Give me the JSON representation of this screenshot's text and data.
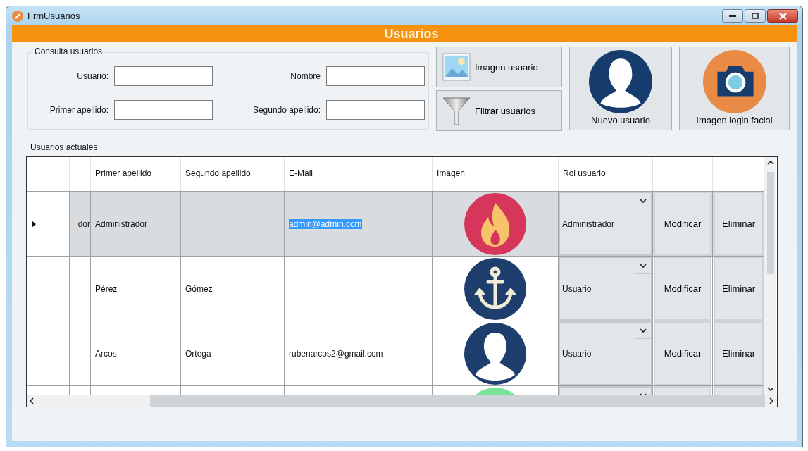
{
  "window": {
    "title": "FrmUsuarios"
  },
  "header": {
    "title": "Usuarios"
  },
  "search_group": {
    "title": "Consulta usuarios",
    "fields": [
      {
        "label": "Usuario:"
      },
      {
        "label": "Nombre"
      },
      {
        "label": "Primer apellido:"
      },
      {
        "label": "Segundo apellido:"
      }
    ]
  },
  "side_buttons": [
    {
      "label": "Imagen usuario",
      "kind": "image"
    },
    {
      "label": "Filtrar usuarios",
      "kind": "filter"
    }
  ],
  "big_buttons": [
    {
      "label": "Nuevo usuario",
      "kind": "user"
    },
    {
      "label": "Imagen login facial",
      "kind": "camera"
    }
  ],
  "table": {
    "title": "Usuarios actuales",
    "columns": [
      "Primer apellido",
      "Segundo apellido",
      "E-Mail",
      "Imagen",
      "Rol usuario"
    ],
    "rows": [
      {
        "selected": true,
        "column_1": "dor",
        "primer_apellido": "Administrador",
        "email": "admin@admin.com",
        "kind": "fire",
        "rol": "Administrador",
        "actions": [
          "Modificar",
          "Eliminar"
        ]
      },
      {
        "selected": false,
        "primer_apellido": "Pérez",
        "segundo_apellido": "Gómez",
        "kind": "anchor",
        "rol": "Usuario",
        "actions": [
          "Modificar",
          "Eliminar"
        ]
      },
      {
        "selected": false,
        "primer_apellido": "Arcos",
        "segundo_apellido": "Ortega",
        "email": "rubenarcos2@gmail.com",
        "kind": "person",
        "rol": "Usuario",
        "actions": [
          "Modificar",
          "Eliminar"
        ]
      },
      {
        "selected": false,
        "kind": "blank"
      }
    ]
  }
}
